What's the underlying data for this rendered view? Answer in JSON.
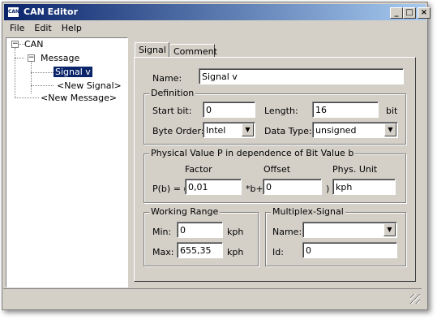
{
  "window": {
    "title": "CAN Editor",
    "icon_text": "CAN",
    "buttons": {
      "minimize": "_",
      "maximize": "□",
      "close": "×"
    }
  },
  "menu": {
    "items": [
      "File",
      "Edit",
      "Help"
    ]
  },
  "tree": {
    "root": "CAN",
    "message": "Message",
    "signal": "Signal v",
    "new_signal": "<New Signal>",
    "new_message": "<New Message>",
    "expand_glyph": "−"
  },
  "tabs": [
    {
      "label": "Signal",
      "active": true
    },
    {
      "label": "Comment",
      "active": false
    }
  ],
  "signal": {
    "name_label": "Name:",
    "name_value": "Signal v",
    "definition": {
      "legend": "Definition",
      "start_bit_label": "Start bit:",
      "start_bit_value": "0",
      "length_label": "Length:",
      "length_value": "16",
      "length_unit": "bit",
      "byte_order_label": "Byte Order:",
      "byte_order_value": "Intel",
      "data_type_label": "Data Type:",
      "data_type_value": "unsigned"
    },
    "physical": {
      "legend": "Physical Value P in dependence of Bit Value b",
      "factor_header": "Factor",
      "offset_header": "Offset",
      "unit_header": "Phys. Unit",
      "formula_prefix": "P(b) = (",
      "formula_mid": "*b+",
      "formula_suffix": ")",
      "factor_value": "0,01",
      "offset_value": "0",
      "unit_value": "kph"
    },
    "working_range": {
      "legend": "Working Range",
      "min_label": "Min:",
      "min_value": "0",
      "min_unit": "kph",
      "max_label": "Max:",
      "max_value": "655,35",
      "max_unit": "kph"
    },
    "multiplex": {
      "legend": "Multiplex-Signal",
      "name_label": "Name:",
      "name_value": "",
      "id_label": "Id:",
      "id_value": "0"
    }
  },
  "dropdown_arrow": "▼"
}
